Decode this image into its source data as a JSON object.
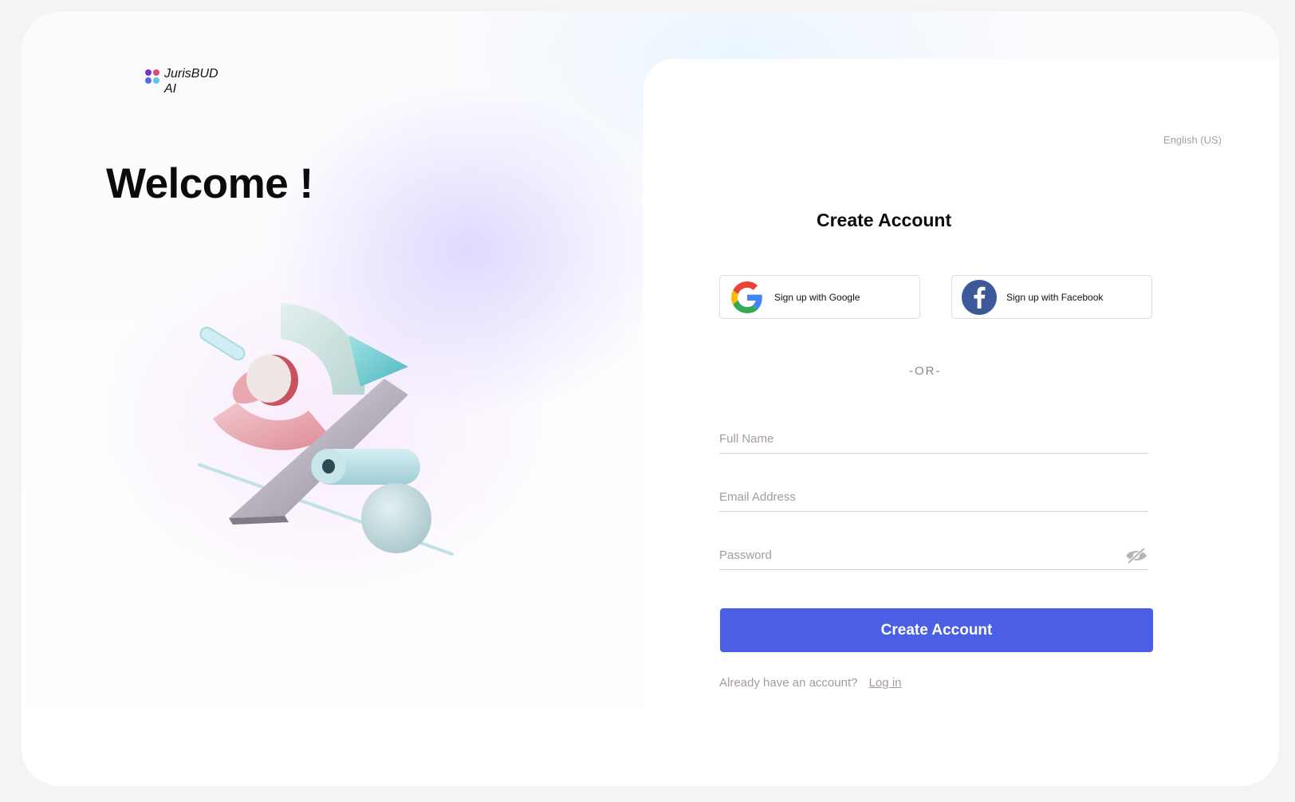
{
  "brand": {
    "name": "JurisBUD AI",
    "logo_colors": [
      "#7b2fd1",
      "#e0487a",
      "#4f6ce6",
      "#5fc3e8"
    ]
  },
  "hero": {
    "welcome": "Welcome !"
  },
  "form": {
    "language": "English (US)",
    "title": "Create Account",
    "google_label": "Sign up with Google",
    "facebook_label": "Sign up with Facebook",
    "divider": "-OR-",
    "full_name_placeholder": "Full Name",
    "email_placeholder": "Email Address",
    "password_placeholder": "Password",
    "submit_label": "Create Account",
    "login_prompt": "Already have an account?",
    "login_link": "Log in"
  },
  "colors": {
    "primary": "#4a5fe3",
    "facebook": "#3b5998"
  }
}
